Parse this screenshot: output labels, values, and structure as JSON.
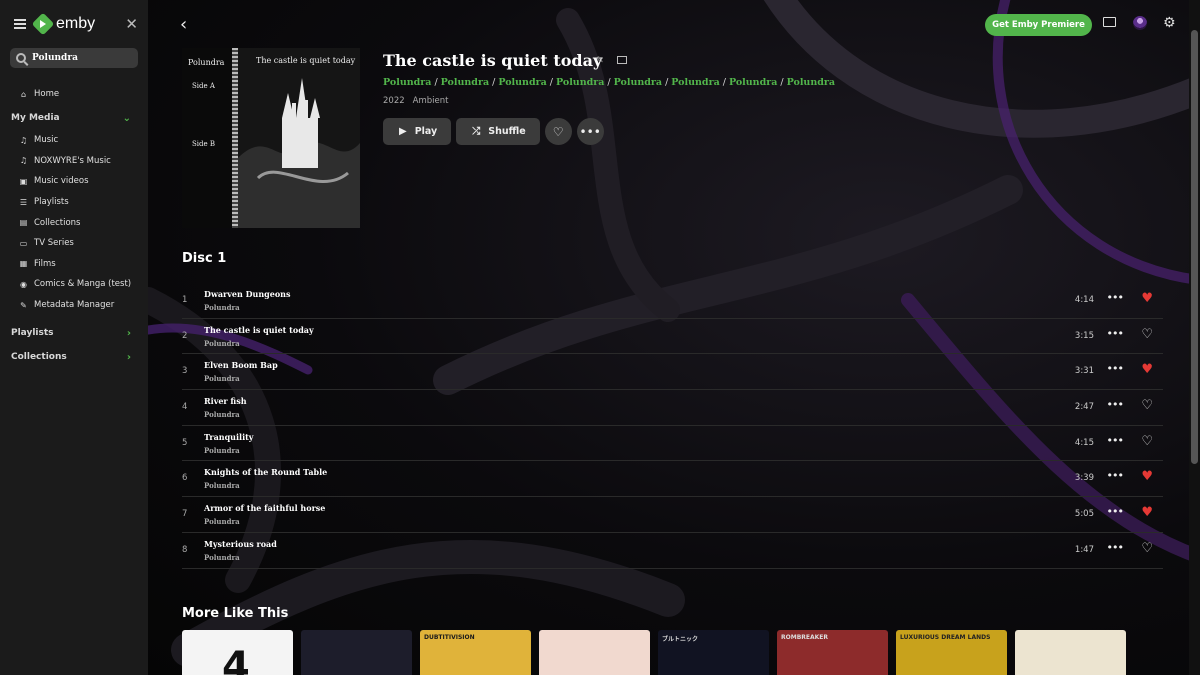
{
  "app": {
    "name": "emby",
    "premiere_label": "Get Emby Premiere",
    "brand_color": "#52b54b"
  },
  "sidebar": {
    "search_value": "Polundra",
    "home_label": "Home",
    "my_media_label": "My Media",
    "items": [
      {
        "label": "Music",
        "icon": "headphones-icon"
      },
      {
        "label": "NOXWYRE's Music",
        "icon": "headphones-icon"
      },
      {
        "label": "Music videos",
        "icon": "music-video-icon"
      },
      {
        "label": "Playlists",
        "icon": "playlist-icon"
      },
      {
        "label": "Collections",
        "icon": "collections-icon"
      },
      {
        "label": "TV Series",
        "icon": "tv-icon"
      },
      {
        "label": "Films",
        "icon": "film-icon"
      },
      {
        "label": "Comics & Manga (test)",
        "icon": "book-icon"
      },
      {
        "label": "Metadata Manager",
        "icon": "pencil-icon"
      }
    ],
    "playlists_label": "Playlists",
    "collections_label": "Collections"
  },
  "album": {
    "title": "The castle is quiet today",
    "artists": [
      "Polundra",
      "Polundra",
      "Polundra",
      "Polundra",
      "Polundra",
      "Polundra",
      "Polundra",
      "Polundra"
    ],
    "year": "2022",
    "genre": "Ambient",
    "play_label": "Play",
    "shuffle_label": "Shuffle",
    "cover": {
      "title": "The castle is quiet today",
      "artist": "Polundra",
      "side_a": "Side A",
      "side_b": "Side B"
    }
  },
  "disc_label": "Disc 1",
  "tracks": [
    {
      "num": "1",
      "title": "Dwarven Dungeons",
      "artist": "Polundra",
      "duration": "4:14",
      "favorite": true
    },
    {
      "num": "2",
      "title": "The castle is quiet today",
      "artist": "Polundra",
      "duration": "3:15",
      "favorite": false
    },
    {
      "num": "3",
      "title": "Elven Boom Bap",
      "artist": "Polundra",
      "duration": "3:31",
      "favorite": true
    },
    {
      "num": "4",
      "title": "River fish",
      "artist": "Polundra",
      "duration": "2:47",
      "favorite": false
    },
    {
      "num": "5",
      "title": "Tranquility",
      "artist": "Polundra",
      "duration": "4:15",
      "favorite": false
    },
    {
      "num": "6",
      "title": "Knights of the Round Table",
      "artist": "Polundra",
      "duration": "3:39",
      "favorite": true
    },
    {
      "num": "7",
      "title": "Armor of the faithful horse",
      "artist": "Polundra",
      "duration": "5:05",
      "favorite": true
    },
    {
      "num": "8",
      "title": "Mysterious road",
      "artist": "Polundra",
      "duration": "1:47",
      "favorite": false
    }
  ],
  "more_like_this": {
    "label": "More Like This",
    "cards": [
      {
        "label": "4",
        "bg": "#f4f4f4",
        "fg": "#111"
      },
      {
        "label": "",
        "bg": "#1d1d2b",
        "fg": "#59ff6a"
      },
      {
        "label": "DUBTITIVISION",
        "bg": "#e0b33a",
        "fg": "#1a1a1a"
      },
      {
        "label": "",
        "bg": "#f1d9cf",
        "fg": "#d43a2f"
      },
      {
        "label": "ブルトニック",
        "bg": "#111322",
        "fg": "#ddd"
      },
      {
        "label": "ROMBREAKER",
        "bg": "#8d2b2b",
        "fg": "#ddd"
      },
      {
        "label": "LUXURIOUS DREAM LANDS",
        "bg": "#c8a21c",
        "fg": "#222"
      },
      {
        "label": "",
        "bg": "#ece4d0",
        "fg": "#333"
      }
    ]
  }
}
